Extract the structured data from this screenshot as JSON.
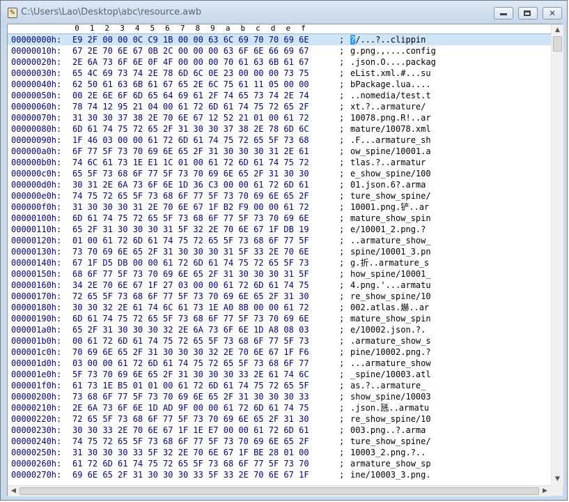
{
  "window": {
    "title": "C:\\Users\\Lao\\Desktop\\abc\\resource.awb",
    "app_icon": "document-icon",
    "buttons": {
      "minimize": "minimize-icon",
      "maximize": "maximize-icon",
      "close": "close-icon"
    }
  },
  "hex_view": {
    "column_header": [
      "0",
      "1",
      "2",
      "3",
      "4",
      "5",
      "6",
      "7",
      "8",
      "9",
      "a",
      "b",
      "c",
      "d",
      "e",
      "f"
    ],
    "selected_row": 0,
    "selected_char_index": 0,
    "rows": [
      {
        "offset": "00000000h:",
        "hex": "E9 2F 00 00 0C C9 1B 00 00 63 6C 69 70 70 69 6E",
        "sep": ";",
        "ascii": "?/...?..clippin"
      },
      {
        "offset": "00000010h:",
        "hex": "67 2E 70 6E 67 0B 2C 00 00 00 63 6F 6E 66 69 67",
        "sep": ";",
        "ascii": "g.png.,....config"
      },
      {
        "offset": "00000020h:",
        "hex": "2E 6A 73 6F 6E 0F 4F 00 00 00 70 61 63 6B 61 67",
        "sep": ";",
        "ascii": ".json.O....packag"
      },
      {
        "offset": "00000030h:",
        "hex": "65 4C 69 73 74 2E 78 6D 6C 0E 23 00 00 00 73 75",
        "sep": ";",
        "ascii": "eList.xml.#...su"
      },
      {
        "offset": "00000040h:",
        "hex": "62 50 61 63 6B 61 67 65 2E 6C 75 61 11 05 00 00",
        "sep": ";",
        "ascii": "bPackage.lua...."
      },
      {
        "offset": "00000050h:",
        "hex": "00 2E 6E 6F 6D 65 64 69 61 2F 74 65 73 74 2E 74",
        "sep": ";",
        "ascii": "..nomedia/test.t"
      },
      {
        "offset": "00000060h:",
        "hex": "78 74 12 95 21 04 00 61 72 6D 61 74 75 72 65 2F",
        "sep": ";",
        "ascii": "xt.?..armature/"
      },
      {
        "offset": "00000070h:",
        "hex": "31 30 30 37 38 2E 70 6E 67 12 52 21 01 00 61 72",
        "sep": ";",
        "ascii": "10078.png.R!..ar"
      },
      {
        "offset": "00000080h:",
        "hex": "6D 61 74 75 72 65 2F 31 30 30 37 38 2E 78 6D 6C",
        "sep": ";",
        "ascii": "mature/10078.xml"
      },
      {
        "offset": "00000090h:",
        "hex": "1F 46 03 00 00 61 72 6D 61 74 75 72 65 5F 73 68",
        "sep": ";",
        "ascii": ".F...armature_sh"
      },
      {
        "offset": "000000a0h:",
        "hex": "6F 77 5F 73 70 69 6E 65 2F 31 30 30 30 31 2E 61",
        "sep": ";",
        "ascii": "ow_spine/10001.a"
      },
      {
        "offset": "000000b0h:",
        "hex": "74 6C 61 73 1E E1 1C 01 00 61 72 6D 61 74 75 72",
        "sep": ";",
        "ascii": "tlas.?..armatur"
      },
      {
        "offset": "000000c0h:",
        "hex": "65 5F 73 68 6F 77 5F 73 70 69 6E 65 2F 31 30 30",
        "sep": ";",
        "ascii": "e_show_spine/100"
      },
      {
        "offset": "000000d0h:",
        "hex": "30 31 2E 6A 73 6F 6E 1D 36 C3 00 00 61 72 6D 61",
        "sep": ";",
        "ascii": "01.json.6?.arma"
      },
      {
        "offset": "000000e0h:",
        "hex": "74 75 72 65 5F 73 68 6F 77 5F 73 70 69 6E 65 2F",
        "sep": ";",
        "ascii": "ture_show_spine/"
      },
      {
        "offset": "000000f0h:",
        "hex": "31 30 30 30 31 2E 70 6E 67 1F B2 F9 00 00 61 72",
        "sep": ";",
        "ascii": "10001.png.铲..ar"
      },
      {
        "offset": "00000100h:",
        "hex": "6D 61 74 75 72 65 5F 73 68 6F 77 5F 73 70 69 6E",
        "sep": ";",
        "ascii": "mature_show_spin"
      },
      {
        "offset": "00000110h:",
        "hex": "65 2F 31 30 30 30 31 5F 32 2E 70 6E 67 1F DB 19",
        "sep": ";",
        "ascii": "e/10001_2.png.?"
      },
      {
        "offset": "00000120h:",
        "hex": "01 00 61 72 6D 61 74 75 72 65 5F 73 68 6F 77 5F",
        "sep": ";",
        "ascii": "..armature_show_"
      },
      {
        "offset": "00000130h:",
        "hex": "73 70 69 6E 65 2F 31 30 30 30 31 5F 33 2E 70 6E",
        "sep": ";",
        "ascii": "spine/10001_3.pn"
      },
      {
        "offset": "00000140h:",
        "hex": "67 1F D5 DB 00 00 61 72 6D 61 74 75 72 65 5F 73",
        "sep": ";",
        "ascii": "g.折..armature_s"
      },
      {
        "offset": "00000150h:",
        "hex": "68 6F 77 5F 73 70 69 6E 65 2F 31 30 30 30 31 5F",
        "sep": ";",
        "ascii": "how_spine/10001_"
      },
      {
        "offset": "00000160h:",
        "hex": "34 2E 70 6E 67 1F 27 03 00 00 61 72 6D 61 74 75",
        "sep": ";",
        "ascii": "4.png.'...armatu"
      },
      {
        "offset": "00000170h:",
        "hex": "72 65 5F 73 68 6F 77 5F 73 70 69 6E 65 2F 31 30",
        "sep": ";",
        "ascii": "re_show_spine/10"
      },
      {
        "offset": "00000180h:",
        "hex": "30 30 32 2E 61 74 6C 61 73 1E A0 8B 00 00 61 72",
        "sep": ";",
        "ascii": "002.atlas.爀..ar"
      },
      {
        "offset": "00000190h:",
        "hex": "6D 61 74 75 72 65 5F 73 68 6F 77 5F 73 70 69 6E",
        "sep": ";",
        "ascii": "mature_show_spin"
      },
      {
        "offset": "000001a0h:",
        "hex": "65 2F 31 30 30 30 32 2E 6A 73 6F 6E 1D A8 08 03",
        "sep": ";",
        "ascii": "e/10002.json.?."
      },
      {
        "offset": "000001b0h:",
        "hex": "00 61 72 6D 61 74 75 72 65 5F 73 68 6F 77 5F 73",
        "sep": ";",
        "ascii": ".armature_show_s"
      },
      {
        "offset": "000001c0h:",
        "hex": "70 69 6E 65 2F 31 30 30 30 32 2E 70 6E 67 1F F6",
        "sep": ";",
        "ascii": "pine/10002.png.?"
      },
      {
        "offset": "000001d0h:",
        "hex": "03 00 00 61 72 6D 61 74 75 72 65 5F 73 68 6F 77",
        "sep": ";",
        "ascii": "...armature_show"
      },
      {
        "offset": "000001e0h:",
        "hex": "5F 73 70 69 6E 65 2F 31 30 30 30 33 2E 61 74 6C",
        "sep": ";",
        "ascii": "_spine/10003.atl"
      },
      {
        "offset": "000001f0h:",
        "hex": "61 73 1E B5 01 01 00 61 72 6D 61 74 75 72 65 5F",
        "sep": ";",
        "ascii": "as.?..armature_"
      },
      {
        "offset": "00000200h:",
        "hex": "73 68 6F 77 5F 73 70 69 6E 65 2F 31 30 30 30 33",
        "sep": ";",
        "ascii": "show_spine/10003"
      },
      {
        "offset": "00000210h:",
        "hex": "2E 6A 73 6F 6E 1D AD 9F 00 00 61 72 6D 61 74 75",
        "sep": ";",
        "ascii": ".json.瓱..armatu"
      },
      {
        "offset": "00000220h:",
        "hex": "72 65 5F 73 68 6F 77 5F 73 70 69 6E 65 2F 31 30",
        "sep": ";",
        "ascii": "re_show_spine/10"
      },
      {
        "offset": "00000230h:",
        "hex": "30 30 33 2E 70 6E 67 1F 1E E7 00 00 61 72 6D 61",
        "sep": ";",
        "ascii": "003.png..?.arma"
      },
      {
        "offset": "00000240h:",
        "hex": "74 75 72 65 5F 73 68 6F 77 5F 73 70 69 6E 65 2F",
        "sep": ";",
        "ascii": "ture_show_spine/"
      },
      {
        "offset": "00000250h:",
        "hex": "31 30 30 30 33 5F 32 2E 70 6E 67 1F BE 28 01 00",
        "sep": ";",
        "ascii": "10003_2.png.?.."
      },
      {
        "offset": "00000260h:",
        "hex": "61 72 6D 61 74 75 72 65 5F 73 68 6F 77 5F 73 70",
        "sep": ";",
        "ascii": "armature_show_sp"
      },
      {
        "offset": "00000270h:",
        "hex": "69 6E 65 2F 31 30 30 30 33 5F 33 2E 70 6E 67 1F",
        "sep": ";",
        "ascii": "ine/10003_3.png."
      }
    ]
  },
  "scrollbars": {
    "up": "scroll-up-arrow-icon",
    "down": "scroll-down-arrow-icon",
    "left": "scroll-left-arrow-icon",
    "right": "scroll-right-arrow-icon"
  }
}
